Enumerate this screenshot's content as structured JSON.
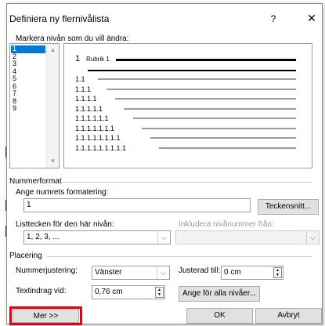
{
  "dialog": {
    "title": "Definiera ny flernivålista",
    "help_label": "?",
    "close_label": "✕"
  },
  "level_section": {
    "label": "Markera nivån som du vill ändra:",
    "levels": [
      "1",
      "2",
      "3",
      "4",
      "5",
      "6",
      "7",
      "8",
      "9"
    ],
    "selected_index": 0
  },
  "preview": {
    "heading_number": "1",
    "heading_text": "Rubrik 1",
    "rows": [
      "1.1",
      "1.1.1",
      "1.1.1.1",
      "1.1.1.1.1",
      "1.1.1.1.1.1",
      "1.1.1.1.1.1.1",
      "1.1.1.1.1.1.1.1",
      "1.1.1.1.1.1.1.1.1"
    ]
  },
  "number_format": {
    "group_label": "Nummerformat",
    "format_label": "Ange numrets formatering:",
    "format_value": "1",
    "font_button": "Teckensnitt...",
    "style_label": "Listtecken för den här nivån:",
    "style_value": "1, 2, 3, ...",
    "include_label": "Inkludera nivånummer från:",
    "include_value": ""
  },
  "placement": {
    "group_label": "Placering",
    "alignment_label": "Nummerjustering:",
    "alignment_value": "Vänster",
    "aligned_at_label": "Justerad till:",
    "aligned_at_value": "0 cm",
    "indent_label": "Textindrag vid:",
    "indent_value": "0,76 cm",
    "set_all_button": "Ange för alla nivåer..."
  },
  "footer": {
    "more_button": "Mer >>",
    "ok_button": "OK",
    "cancel_button": "Avbryt"
  },
  "colors": {
    "selection": "#0078d7",
    "highlight": "#e4000f"
  }
}
